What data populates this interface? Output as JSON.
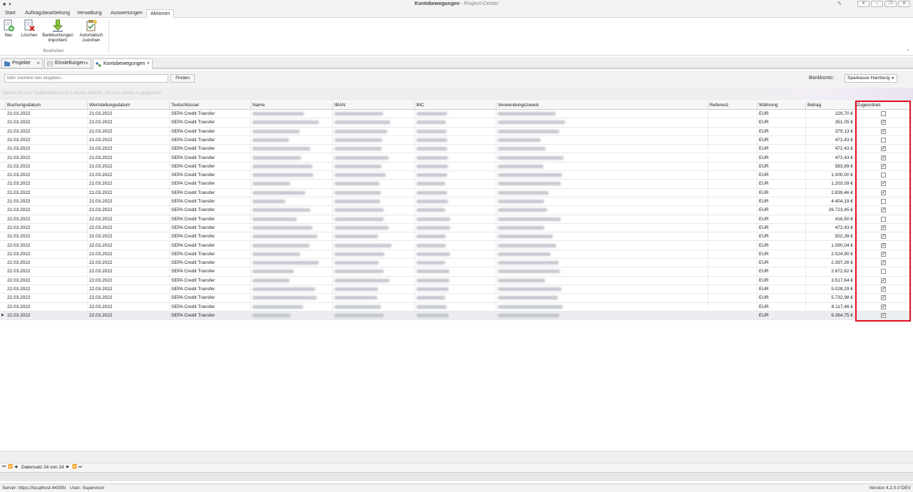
{
  "window": {
    "title": "Kontobewegungen",
    "app_suffix": "Project-Center",
    "buttons": [
      "✕",
      "–",
      "❐",
      "✕"
    ]
  },
  "ribbon": {
    "tabs": [
      "Start",
      "Auftragsbearbeitung",
      "Verwaltung",
      "Auswertungen",
      "Aktionen"
    ],
    "active_tab": "Aktionen",
    "buttons": [
      {
        "label": "Neu",
        "icon": "new-document-icon"
      },
      {
        "label": "Löschen",
        "icon": "delete-document-icon"
      },
      {
        "label": "Bankbuchungen importiern",
        "icon": "import-arrow-icon"
      },
      {
        "label": "Automatisch zuordnen",
        "icon": "auto-assign-icon"
      }
    ],
    "group_label": "Bearbeiten"
  },
  "doc_tabs": [
    {
      "label": "Projekte",
      "icon": "projects-icon"
    },
    {
      "label": "Einstellungen",
      "icon": "settings-doc-icon"
    },
    {
      "label": "Kontobewegungen",
      "icon": "transactions-icon",
      "active": true
    }
  ],
  "search": {
    "placeholder": "Bitte Suchtext hier eingeben...",
    "find_label": "Finden",
    "bank_label": "Bankkonto:",
    "bank_value": "Sparkasse Hamburg"
  },
  "group_panel_hint": "Ziehen Sie eine Spaltenüberschrift in diesen Bereich, um nach dieser zu gruppieren",
  "columns": [
    "Buchungsdatum",
    "Wertstellungsdatum",
    "Textschlüssel",
    "Name",
    "IBAN",
    "BIC",
    "Verwendungszweck",
    "Referenz",
    "Währung",
    "Betrag",
    "Zugeordnet"
  ],
  "rows": [
    {
      "booking": "21.03.2022",
      "value_date": "21.03.2022",
      "key": "SEPA Credit Transfer",
      "currency": "EUR",
      "amount": "229,70 €",
      "assigned": false
    },
    {
      "booking": "21.03.2022",
      "value_date": "21.03.2022",
      "key": "SEPA Credit Transfer",
      "currency": "EUR",
      "amount": "351,05 €",
      "assigned": true
    },
    {
      "booking": "21.03.2022",
      "value_date": "21.03.2022",
      "key": "SEPA Credit Transfer",
      "currency": "EUR",
      "amount": "379,13 €",
      "assigned": true
    },
    {
      "booking": "21.03.2022",
      "value_date": "21.03.2022",
      "key": "SEPA Credit Transfer",
      "currency": "EUR",
      "amount": "472,43 €",
      "assigned": false
    },
    {
      "booking": "21.03.2022",
      "value_date": "21.03.2022",
      "key": "SEPA Credit Transfer",
      "currency": "EUR",
      "amount": "472,43 €",
      "assigned": true
    },
    {
      "booking": "21.03.2022",
      "value_date": "21.03.2022",
      "key": "SEPA Credit Transfer",
      "currency": "EUR",
      "amount": "472,43 €",
      "assigned": true
    },
    {
      "booking": "21.03.2022",
      "value_date": "21.03.2022",
      "key": "SEPA Credit Transfer",
      "currency": "EUR",
      "amount": "583,89 €",
      "assigned": true
    },
    {
      "booking": "21.03.2022",
      "value_date": "21.03.2022",
      "key": "SEPA Credit Transfer",
      "currency": "EUR",
      "amount": "1.000,00 €",
      "assigned": false
    },
    {
      "booking": "21.03.2022",
      "value_date": "21.03.2022",
      "key": "SEPA Credit Transfer",
      "currency": "EUR",
      "amount": "1.203,09 €",
      "assigned": true
    },
    {
      "booking": "21.03.2022",
      "value_date": "21.03.2022",
      "key": "SEPA Credit Transfer",
      "currency": "EUR",
      "amount": "2.839,46 €",
      "assigned": true
    },
    {
      "booking": "21.03.2022",
      "value_date": "21.03.2022",
      "key": "SEPA Credit Transfer",
      "currency": "EUR",
      "amount": "4.404,19 €",
      "assigned": false
    },
    {
      "booking": "21.03.2022",
      "value_date": "21.03.2022",
      "key": "SEPA Credit Transfer",
      "currency": "EUR",
      "amount": "26.723,45 €",
      "assigned": true
    },
    {
      "booking": "22.03.2022",
      "value_date": "22.03.2022",
      "key": "SEPA Credit Transfer",
      "currency": "EUR",
      "amount": "416,50 €",
      "assigned": false
    },
    {
      "booking": "22.03.2022",
      "value_date": "22.03.2022",
      "key": "SEPA Credit Transfer",
      "currency": "EUR",
      "amount": "472,43 €",
      "assigned": true
    },
    {
      "booking": "22.03.2022",
      "value_date": "22.03.2022",
      "key": "SEPA Credit Transfer",
      "currency": "EUR",
      "amount": "502,39 €",
      "assigned": true
    },
    {
      "booking": "22.03.2022",
      "value_date": "22.03.2022",
      "key": "SEPA Credit Transfer",
      "currency": "EUR",
      "amount": "1.090,04 €",
      "assigned": true
    },
    {
      "booking": "22.03.2022",
      "value_date": "22.03.2022",
      "key": "SEPA Credit Transfer",
      "currency": "EUR",
      "amount": "2.024,90 €",
      "assigned": true
    },
    {
      "booking": "22.03.2022",
      "value_date": "22.03.2022",
      "key": "SEPA Credit Transfer",
      "currency": "EUR",
      "amount": "2.397,26 €",
      "assigned": true
    },
    {
      "booking": "22.03.2022",
      "value_date": "22.03.2022",
      "key": "SEPA Credit Transfer",
      "currency": "EUR",
      "amount": "2.672,62 €",
      "assigned": false
    },
    {
      "booking": "22.03.2022",
      "value_date": "22.03.2022",
      "key": "SEPA Credit Transfer",
      "currency": "EUR",
      "amount": "3.517,64 €",
      "assigned": true
    },
    {
      "booking": "22.03.2022",
      "value_date": "22.03.2022",
      "key": "SEPA Credit Transfer",
      "currency": "EUR",
      "amount": "5.028,29 €",
      "assigned": true
    },
    {
      "booking": "22.03.2022",
      "value_date": "22.03.2022",
      "key": "SEPA Credit Transfer",
      "currency": "EUR",
      "amount": "5.732,98 €",
      "assigned": true
    },
    {
      "booking": "22.03.2022",
      "value_date": "22.03.2022",
      "key": "SEPA Credit Transfer",
      "currency": "EUR",
      "amount": "6.117,46 €",
      "assigned": true
    },
    {
      "booking": "22.03.2022",
      "value_date": "22.03.2022",
      "key": "SEPA Credit Transfer",
      "currency": "EUR",
      "amount": "9.264,75 €",
      "assigned": true,
      "selected": true
    }
  ],
  "navigator": {
    "record_text": "Datensatz 24 von 24"
  },
  "status": {
    "server": "Server: https://localhost:44305/",
    "user": "User: Supervisor",
    "version": "Version 4.2.0.0 DEV"
  },
  "colors": {
    "highlight_border": "#e0101f",
    "selected_row": "#ecedf0"
  }
}
